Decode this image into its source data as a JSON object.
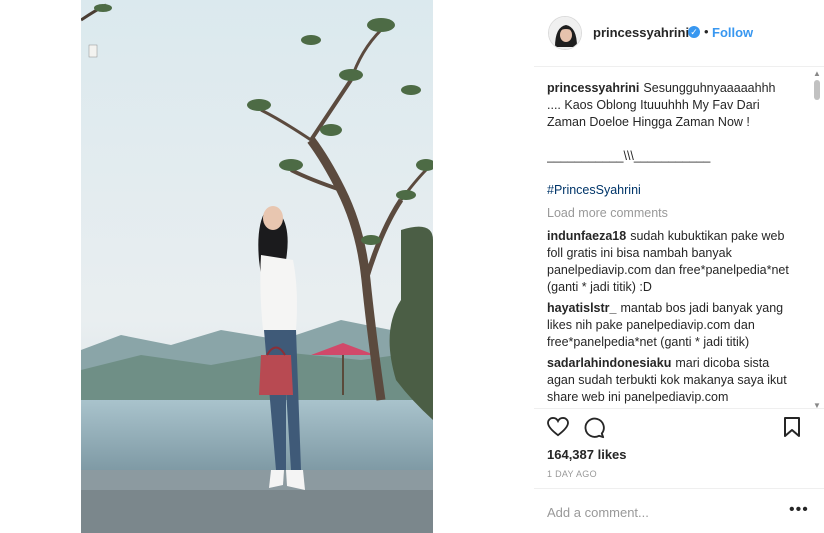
{
  "post": {
    "username": "princessyahrini",
    "verified": true,
    "follow_label": "Follow",
    "separator": "•"
  },
  "caption": {
    "author": "princessyahrini",
    "line1": "Sesungguhnyaaaaahhh",
    "line2": ".... Kaos Oblong Ituuuhhh My Fav Dari",
    "line3": "Zaman Doeloe Hingga Zaman Now !",
    "divider": "___________\\\\\\___________",
    "hashtag": "#PrincesSyahrini"
  },
  "load_more_label": "Load more comments",
  "comments": [
    {
      "author": "indunfaeza18",
      "text": "sudah kubuktikan pake web foll gratis ini bisa nambah banyak panelpediavip.com dan free*panelpedia*net (ganti * jadi titik) :D"
    },
    {
      "author": "hayatislstr_",
      "text": "mantab bos jadi banyak yang likes nih pake panelpediavip.com dan free*panelpedia*net (ganti * jadi titik)"
    },
    {
      "author": "sadarlahindonesiaku",
      "text": "mari dicoba sista agan sudah terbukti kok makanya saya ikut share web ini panelpediavip.com"
    }
  ],
  "likes": "164,387 likes",
  "time": "1 DAY AGO",
  "add_comment_placeholder": "Add a comment...",
  "more_options": "•••",
  "icons": {
    "like": "heart-icon",
    "comment": "comment-icon",
    "save": "bookmark-icon",
    "verified": "verified-badge-icon"
  },
  "colors": {
    "link": "#3897f0",
    "hashtag": "#003569",
    "muted": "#999999",
    "text": "#262626"
  }
}
